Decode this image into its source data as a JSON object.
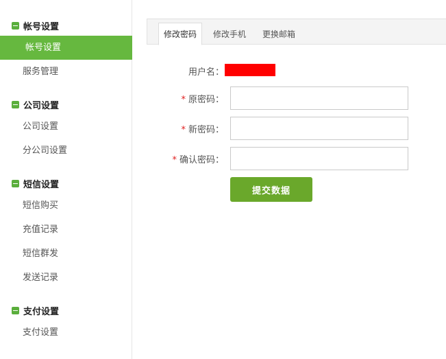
{
  "sidebar": {
    "groups": [
      {
        "title": "帐号设置",
        "items": [
          {
            "label": "帐号设置",
            "active": true
          },
          {
            "label": "服务管理",
            "active": false
          }
        ]
      },
      {
        "title": "公司设置",
        "items": [
          {
            "label": "公司设置",
            "active": false
          },
          {
            "label": "分公司设置",
            "active": false
          }
        ]
      },
      {
        "title": "短信设置",
        "items": [
          {
            "label": "短信购买",
            "active": false
          },
          {
            "label": "充值记录",
            "active": false
          },
          {
            "label": "短信群发",
            "active": false
          },
          {
            "label": "发送记录",
            "active": false
          }
        ]
      },
      {
        "title": "支付设置",
        "items": [
          {
            "label": "支付设置",
            "active": false
          }
        ]
      }
    ]
  },
  "tabs": [
    {
      "label": "修改密码",
      "active": true
    },
    {
      "label": "修改手机",
      "active": false
    },
    {
      "label": "更换邮箱",
      "active": false
    }
  ],
  "form": {
    "username_label": "用户名：",
    "required_mark": "*",
    "old_password_label": "原密码：",
    "new_password_label": "新密码：",
    "confirm_password_label": "确认密码：",
    "old_password_value": "",
    "new_password_value": "",
    "confirm_password_value": "",
    "submit_label": "提交数据"
  },
  "colors": {
    "accent": "#66b83f",
    "submit_bg": "#6aa82b",
    "redacted": "#ff0000",
    "required": "#e02020"
  }
}
